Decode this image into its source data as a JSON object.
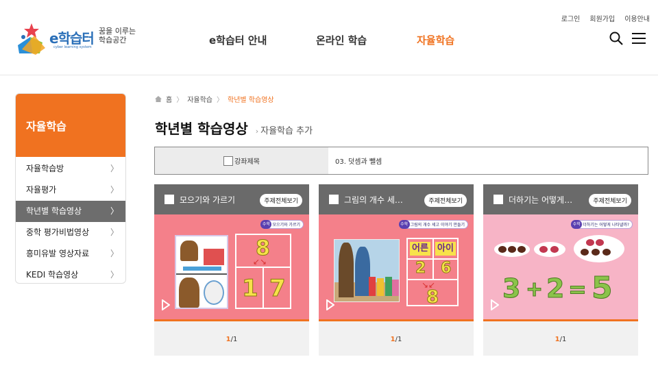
{
  "header": {
    "logo": {
      "brand": "e학습터",
      "sub": "cyber learning system",
      "slogan": "꿈을 이루는 학습공간"
    },
    "util": [
      "로그인",
      "회원가입",
      "이용안내"
    ],
    "nav": [
      {
        "label": "e학습터 안내",
        "active": false
      },
      {
        "label": "온라인 학습",
        "active": false
      },
      {
        "label": "자율학습",
        "active": true
      }
    ]
  },
  "sidebar": {
    "title": "자율학습",
    "items": [
      {
        "label": "자율학습방",
        "active": false
      },
      {
        "label": "자율평가",
        "active": false
      },
      {
        "label": "학년별 학습영상",
        "active": true
      },
      {
        "label": "중학 평가비법영상",
        "active": false
      },
      {
        "label": "흥미유발 영상자료",
        "active": false
      },
      {
        "label": "KEDI 학습영상",
        "active": false
      }
    ]
  },
  "breadcrumb": [
    "홈",
    "자율학습",
    "학년별 학습영상"
  ],
  "page": {
    "title": "학년별 학습영상",
    "subtitle": "자율학습 추가"
  },
  "filter": {
    "label": "강좌제목",
    "value": "03. 덧셈과 뺄셈"
  },
  "cards": [
    {
      "title": "모으기와 가르기",
      "button": "주제전체보기",
      "thumb_tag": "수학",
      "thumb_label": "모으기와 가르기",
      "thumb_bg": "#f4808a",
      "numbers": [
        "8",
        "1",
        "7"
      ],
      "page_current": "1",
      "page_total": "/1"
    },
    {
      "title": "그림의 개수 세…",
      "button": "주제전체보기",
      "thumb_tag": "수학",
      "thumb_label": "그림의 개수 세고 이야기 만들기",
      "thumb_bg": "#f4808a",
      "words": [
        "어른",
        "아이"
      ],
      "numbers": [
        "2",
        "6",
        "8"
      ],
      "page_current": "1",
      "page_total": "/1"
    },
    {
      "title": "더하기는 어떻게…",
      "button": "주제전체보기",
      "thumb_tag": "수학",
      "thumb_label": "더하기는 어떻게 나타낼까?",
      "thumb_bg": "#f7b4c6",
      "equation": [
        "3",
        "+",
        "2",
        "=",
        "5"
      ],
      "page_current": "1",
      "page_total": "/1"
    }
  ],
  "colors": {
    "accent": "#f07220",
    "header_gray": "#6a6a6a",
    "active_gray": "#6d6d6d"
  }
}
